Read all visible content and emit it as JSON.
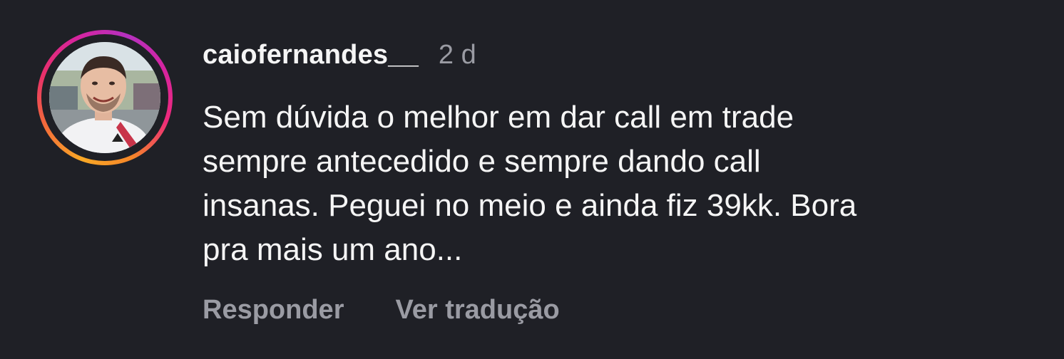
{
  "comment": {
    "username": "caiofernandes__",
    "time": "2 d",
    "text_lines": [
      "Sem dúvida o melhor em dar call em trade",
      "sempre antecedido e sempre dando call",
      "insanas. Peguei no meio e ainda fiz 39kk. Bora",
      "pra mais um ano..."
    ],
    "actions": {
      "reply_label": "Responder",
      "translate_label": "Ver tradução"
    }
  },
  "colors": {
    "background": "#1f2026",
    "text_primary": "#f5f5f5",
    "text_secondary": "#9a9ba3",
    "story_ring_gradient": [
      "#f9a826",
      "#f36b3a",
      "#e8306a",
      "#d6249f",
      "#b531c0"
    ]
  }
}
